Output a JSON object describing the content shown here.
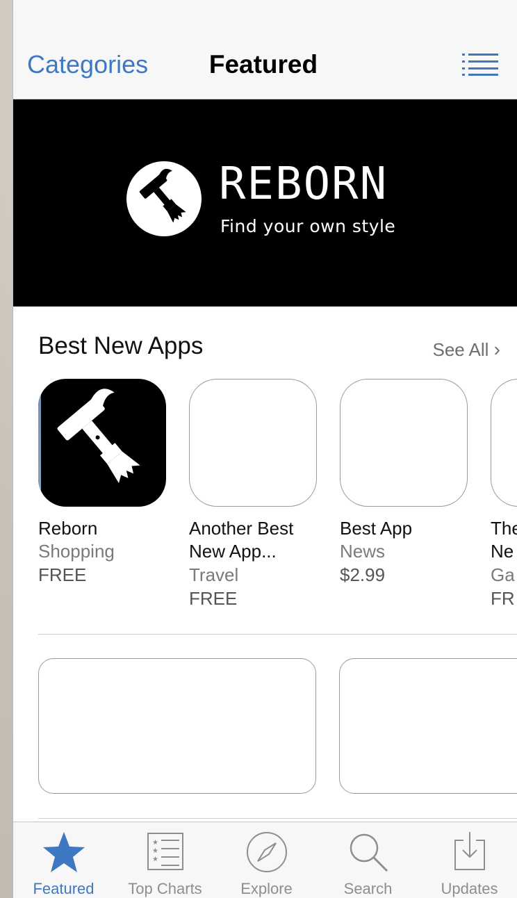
{
  "nav": {
    "left_label": "Categories",
    "title": "Featured",
    "right_icon": "list-icon"
  },
  "banner": {
    "name": "REBORN",
    "tagline": "Find your own style",
    "logo_icon": "hammer-brush-icon"
  },
  "section": {
    "title": "Best New Apps",
    "see_all": "See All"
  },
  "apps": [
    {
      "name": "Reborn",
      "name2": "",
      "category": "Shopping",
      "price": "FREE"
    },
    {
      "name": "Another Best",
      "name2": "New App...",
      "category": "Travel",
      "price": "FREE"
    },
    {
      "name": "Best App",
      "name2": "",
      "category": "News",
      "price": "$2.99"
    },
    {
      "name": "The",
      "name2": "Ne",
      "category": "Ga",
      "price": "FR"
    }
  ],
  "tabs": [
    {
      "label": "Featured",
      "icon": "star-icon",
      "active": true
    },
    {
      "label": "Top Charts",
      "icon": "top-charts-icon",
      "active": false
    },
    {
      "label": "Explore",
      "icon": "compass-icon",
      "active": false
    },
    {
      "label": "Search",
      "icon": "search-icon",
      "active": false
    },
    {
      "label": "Updates",
      "icon": "updates-icon",
      "active": false
    }
  ],
  "colors": {
    "accent": "#3e78c2",
    "tab_inactive": "#8e8e8e",
    "banner_bg": "#000000"
  }
}
